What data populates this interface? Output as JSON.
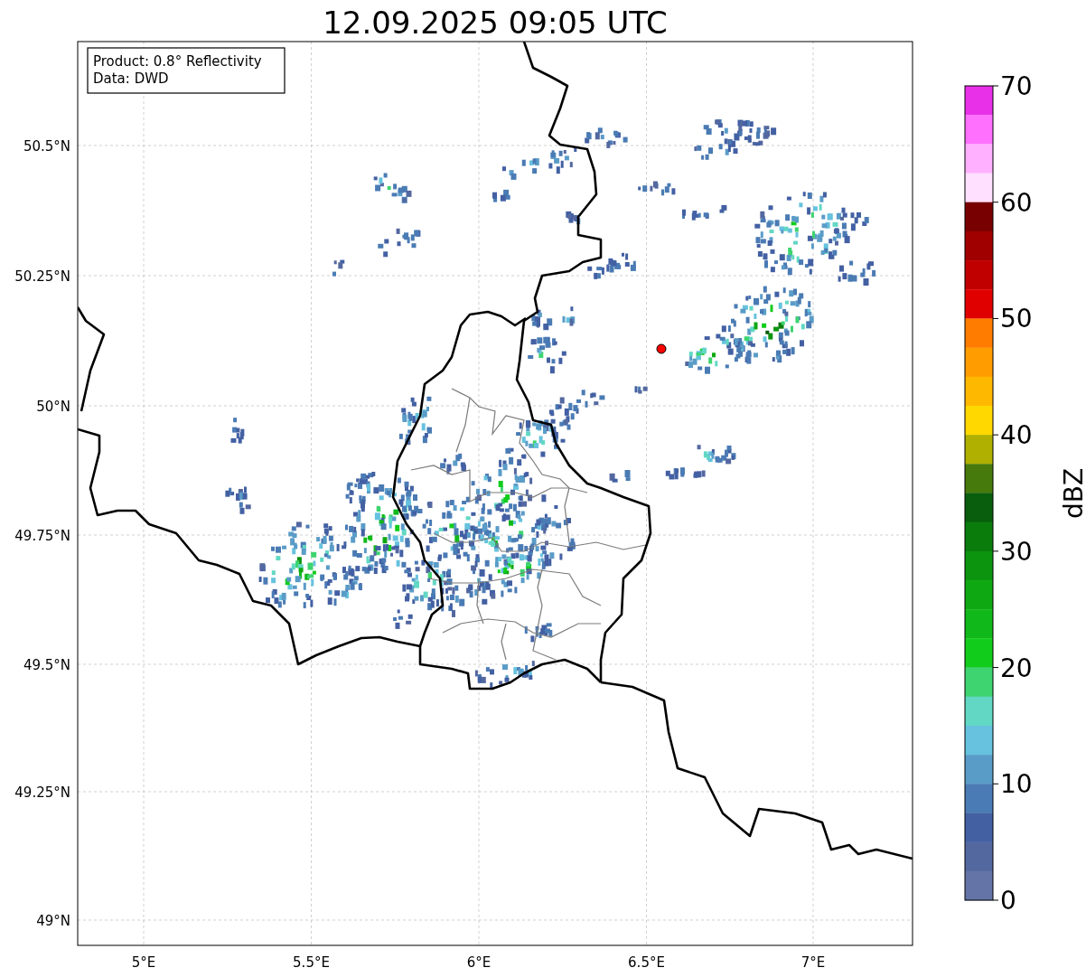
{
  "title": "12.09.2025 09:05 UTC",
  "info_box": [
    "Product: 0.8° Reflectivity",
    "Data: DWD"
  ],
  "axes": {
    "x_ticks": [
      "5°E",
      "5.5°E",
      "6°E",
      "6.5°E",
      "7°E"
    ],
    "y_ticks": [
      "50.5°N",
      "50.25°N",
      "50°N",
      "49.75°N",
      "49.5°N",
      "49.25°N",
      "49°N"
    ]
  },
  "colorbar": {
    "label": "dBZ",
    "ticks": [
      "70",
      "60",
      "50",
      "40",
      "30",
      "20",
      "10",
      "0"
    ],
    "bins": [
      {
        "color": "#e830e8"
      },
      {
        "color": "#ff70ff"
      },
      {
        "color": "#ffb0ff"
      },
      {
        "color": "#ffe0ff"
      },
      {
        "color": "#780000"
      },
      {
        "color": "#a00000"
      },
      {
        "color": "#c00000"
      },
      {
        "color": "#e00000"
      },
      {
        "color": "#ff7c00"
      },
      {
        "color": "#ff9c00"
      },
      {
        "color": "#ffb800"
      },
      {
        "color": "#ffd800"
      },
      {
        "color": "#b0b000"
      },
      {
        "color": "#467a0c"
      },
      {
        "color": "#085e0c"
      },
      {
        "color": "#0a7c0c"
      },
      {
        "color": "#0c940e"
      },
      {
        "color": "#0ea812"
      },
      {
        "color": "#10b81a"
      },
      {
        "color": "#12cc1c"
      },
      {
        "color": "#3ed470"
      },
      {
        "color": "#62d8c4"
      },
      {
        "color": "#66c2de"
      },
      {
        "color": "#5a9cc8"
      },
      {
        "color": "#4a7bb4"
      },
      {
        "color": "#4360a3"
      },
      {
        "color": "#5468a0"
      },
      {
        "color": "#6474a6"
      }
    ]
  }
}
